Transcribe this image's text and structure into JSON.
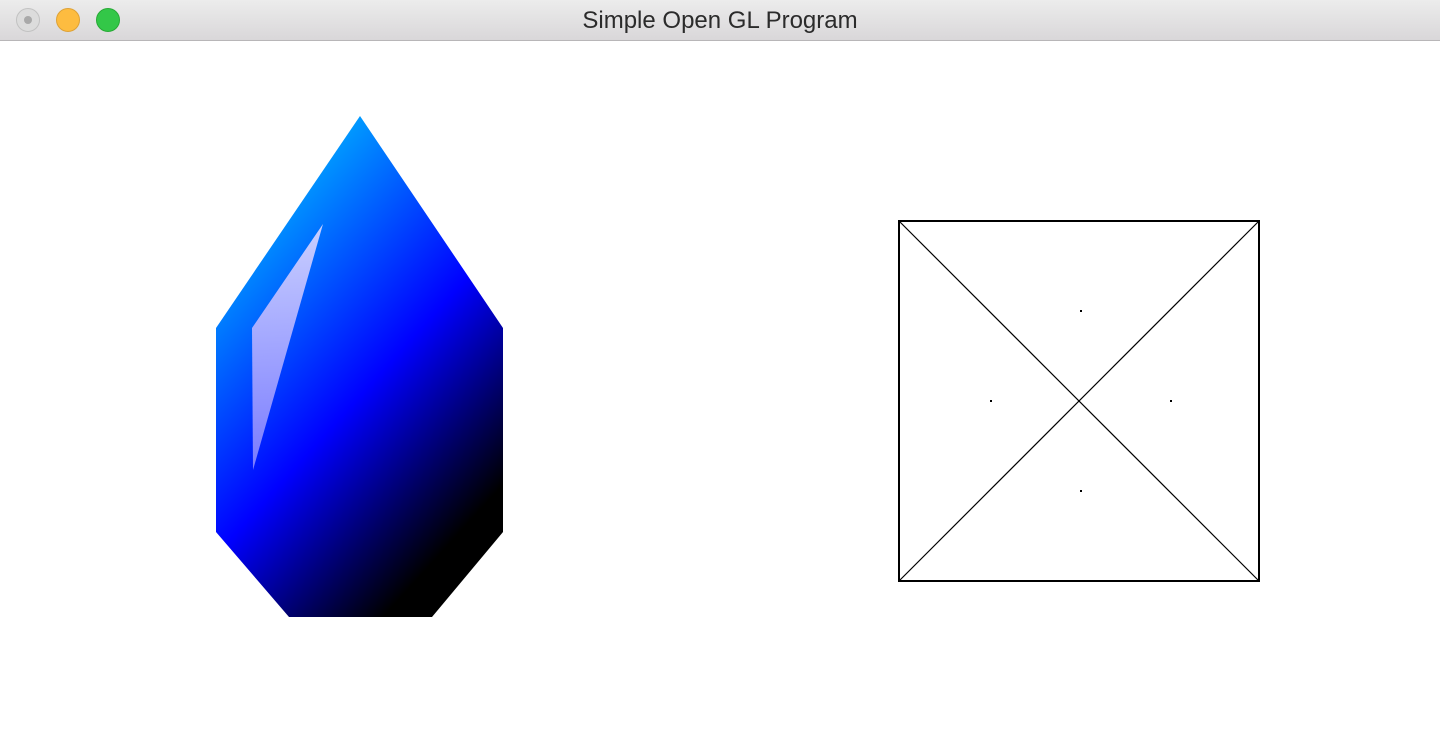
{
  "window": {
    "title": "Simple Open GL Program",
    "background": "#ffffff"
  },
  "titlebar": {
    "buttons": [
      {
        "name": "close-button",
        "color": "#dcdcdc"
      },
      {
        "name": "minimize-button",
        "color": "#fdbc40"
      },
      {
        "name": "zoom-button",
        "color": "#33c748"
      }
    ]
  },
  "scene": {
    "gem": {
      "gradient_colors": [
        "#00c8ff",
        "#0000ff",
        "#000000"
      ],
      "highlight_color": "#c8c8ff"
    },
    "square": {
      "stroke_color": "#000000",
      "diagonals": 2,
      "dots": 4
    }
  }
}
